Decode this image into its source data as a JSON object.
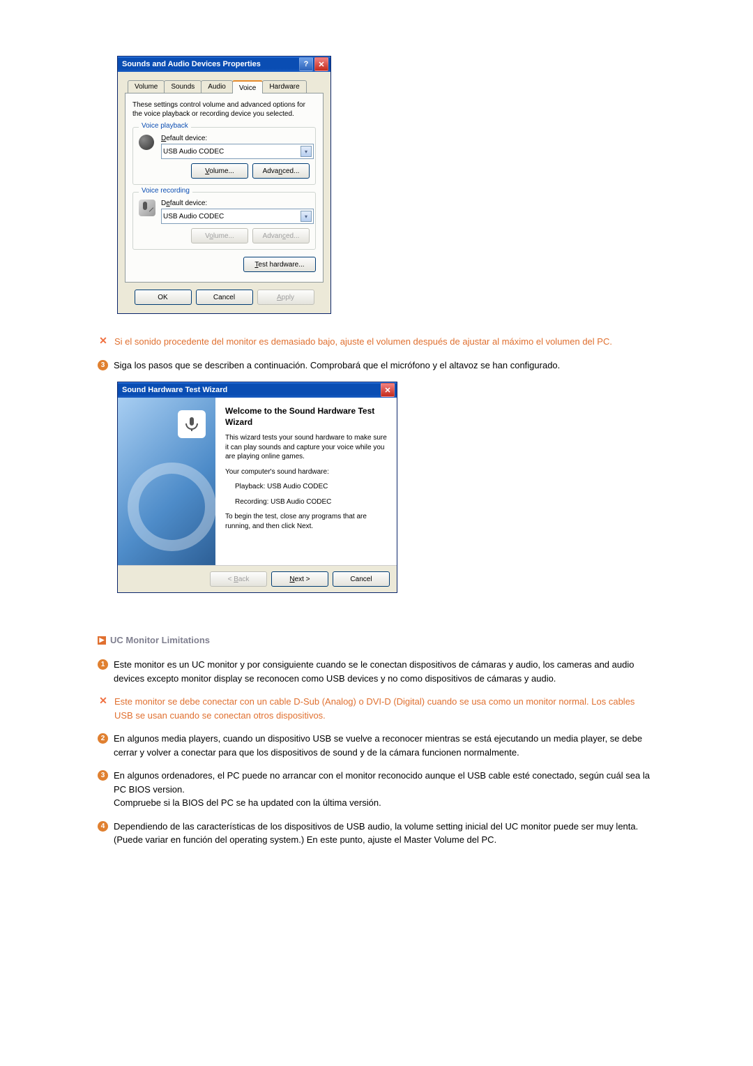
{
  "dialog1": {
    "title": "Sounds and Audio Devices Properties",
    "tabs": [
      "Volume",
      "Sounds",
      "Audio",
      "Voice",
      "Hardware"
    ],
    "active_tab": "Voice",
    "description": "These settings control volume and advanced options for the voice playback or recording device you selected.",
    "playback": {
      "legend": "Voice playback",
      "label_html": "Default device:",
      "value": "USB Audio CODEC",
      "btn_volume": "Volume...",
      "btn_advanced": "Advanced..."
    },
    "recording": {
      "legend": "Voice recording",
      "label_html": "Default device:",
      "value": "USB Audio CODEC",
      "btn_volume": "Volume...",
      "btn_advanced": "Advanced..."
    },
    "btn_test": "Test hardware...",
    "btn_ok": "OK",
    "btn_cancel": "Cancel",
    "btn_apply": "Apply"
  },
  "note1": "Si el sonido procedente del monitor es demasiado bajo, ajuste el volumen después de ajustar al máximo el volumen del PC.",
  "step_pre3_num": "3",
  "step_pre3_text": "Siga los pasos que se describen a continuación. Comprobará que el micrófono y el altavoz se han configurado.",
  "wizard": {
    "title": "Sound Hardware Test Wizard",
    "heading": "Welcome to the Sound Hardware Test Wizard",
    "p1": "This wizard tests your sound hardware to make sure it can play sounds and capture your voice while you are playing online games.",
    "p2": "Your computer's sound hardware:",
    "playback": "Playback:  USB Audio CODEC",
    "recording": "Recording:  USB Audio CODEC",
    "p3": "To begin the test, close any programs that are running, and then click Next.",
    "btn_back": "< Back",
    "btn_next": "Next >",
    "btn_cancel": "Cancel"
  },
  "section": {
    "title": "UC Monitor Limitations"
  },
  "lim1_num": "1",
  "lim1": "Este monitor es un UC monitor y por consiguiente cuando se le conectan dispositivos de cámaras y audio, los cameras and audio devices excepto monitor display se reconocen como USB devices y no como dispositivos de cámaras y audio.",
  "lim1_note": "Este monitor se debe conectar con un cable D-Sub (Analog) o DVI-D (Digital) cuando se usa como un monitor normal. Los cables USB se usan cuando se conectan otros dispositivos.",
  "lim2_num": "2",
  "lim2": "En algunos media players, cuando un dispositivo USB se vuelve a reconocer mientras se está ejecutando un media player, se debe cerrar y volver a conectar para que los dispositivos de sound y de la cámara funcionen normalmente.",
  "lim3_num": "3",
  "lim3": "En algunos ordenadores, el PC puede no arrancar con el monitor reconocido aunque el USB cable esté conectado, según cuál sea la PC BIOS version.\nCompruebe si la BIOS del PC se ha updated con la última versión.",
  "lim4_num": "4",
  "lim4": "Dependiendo de las características de los dispositivos de USB audio, la volume setting inicial del UC monitor puede ser muy lenta. (Puede variar en función del operating system.) En este punto, ajuste el Master Volume del PC."
}
